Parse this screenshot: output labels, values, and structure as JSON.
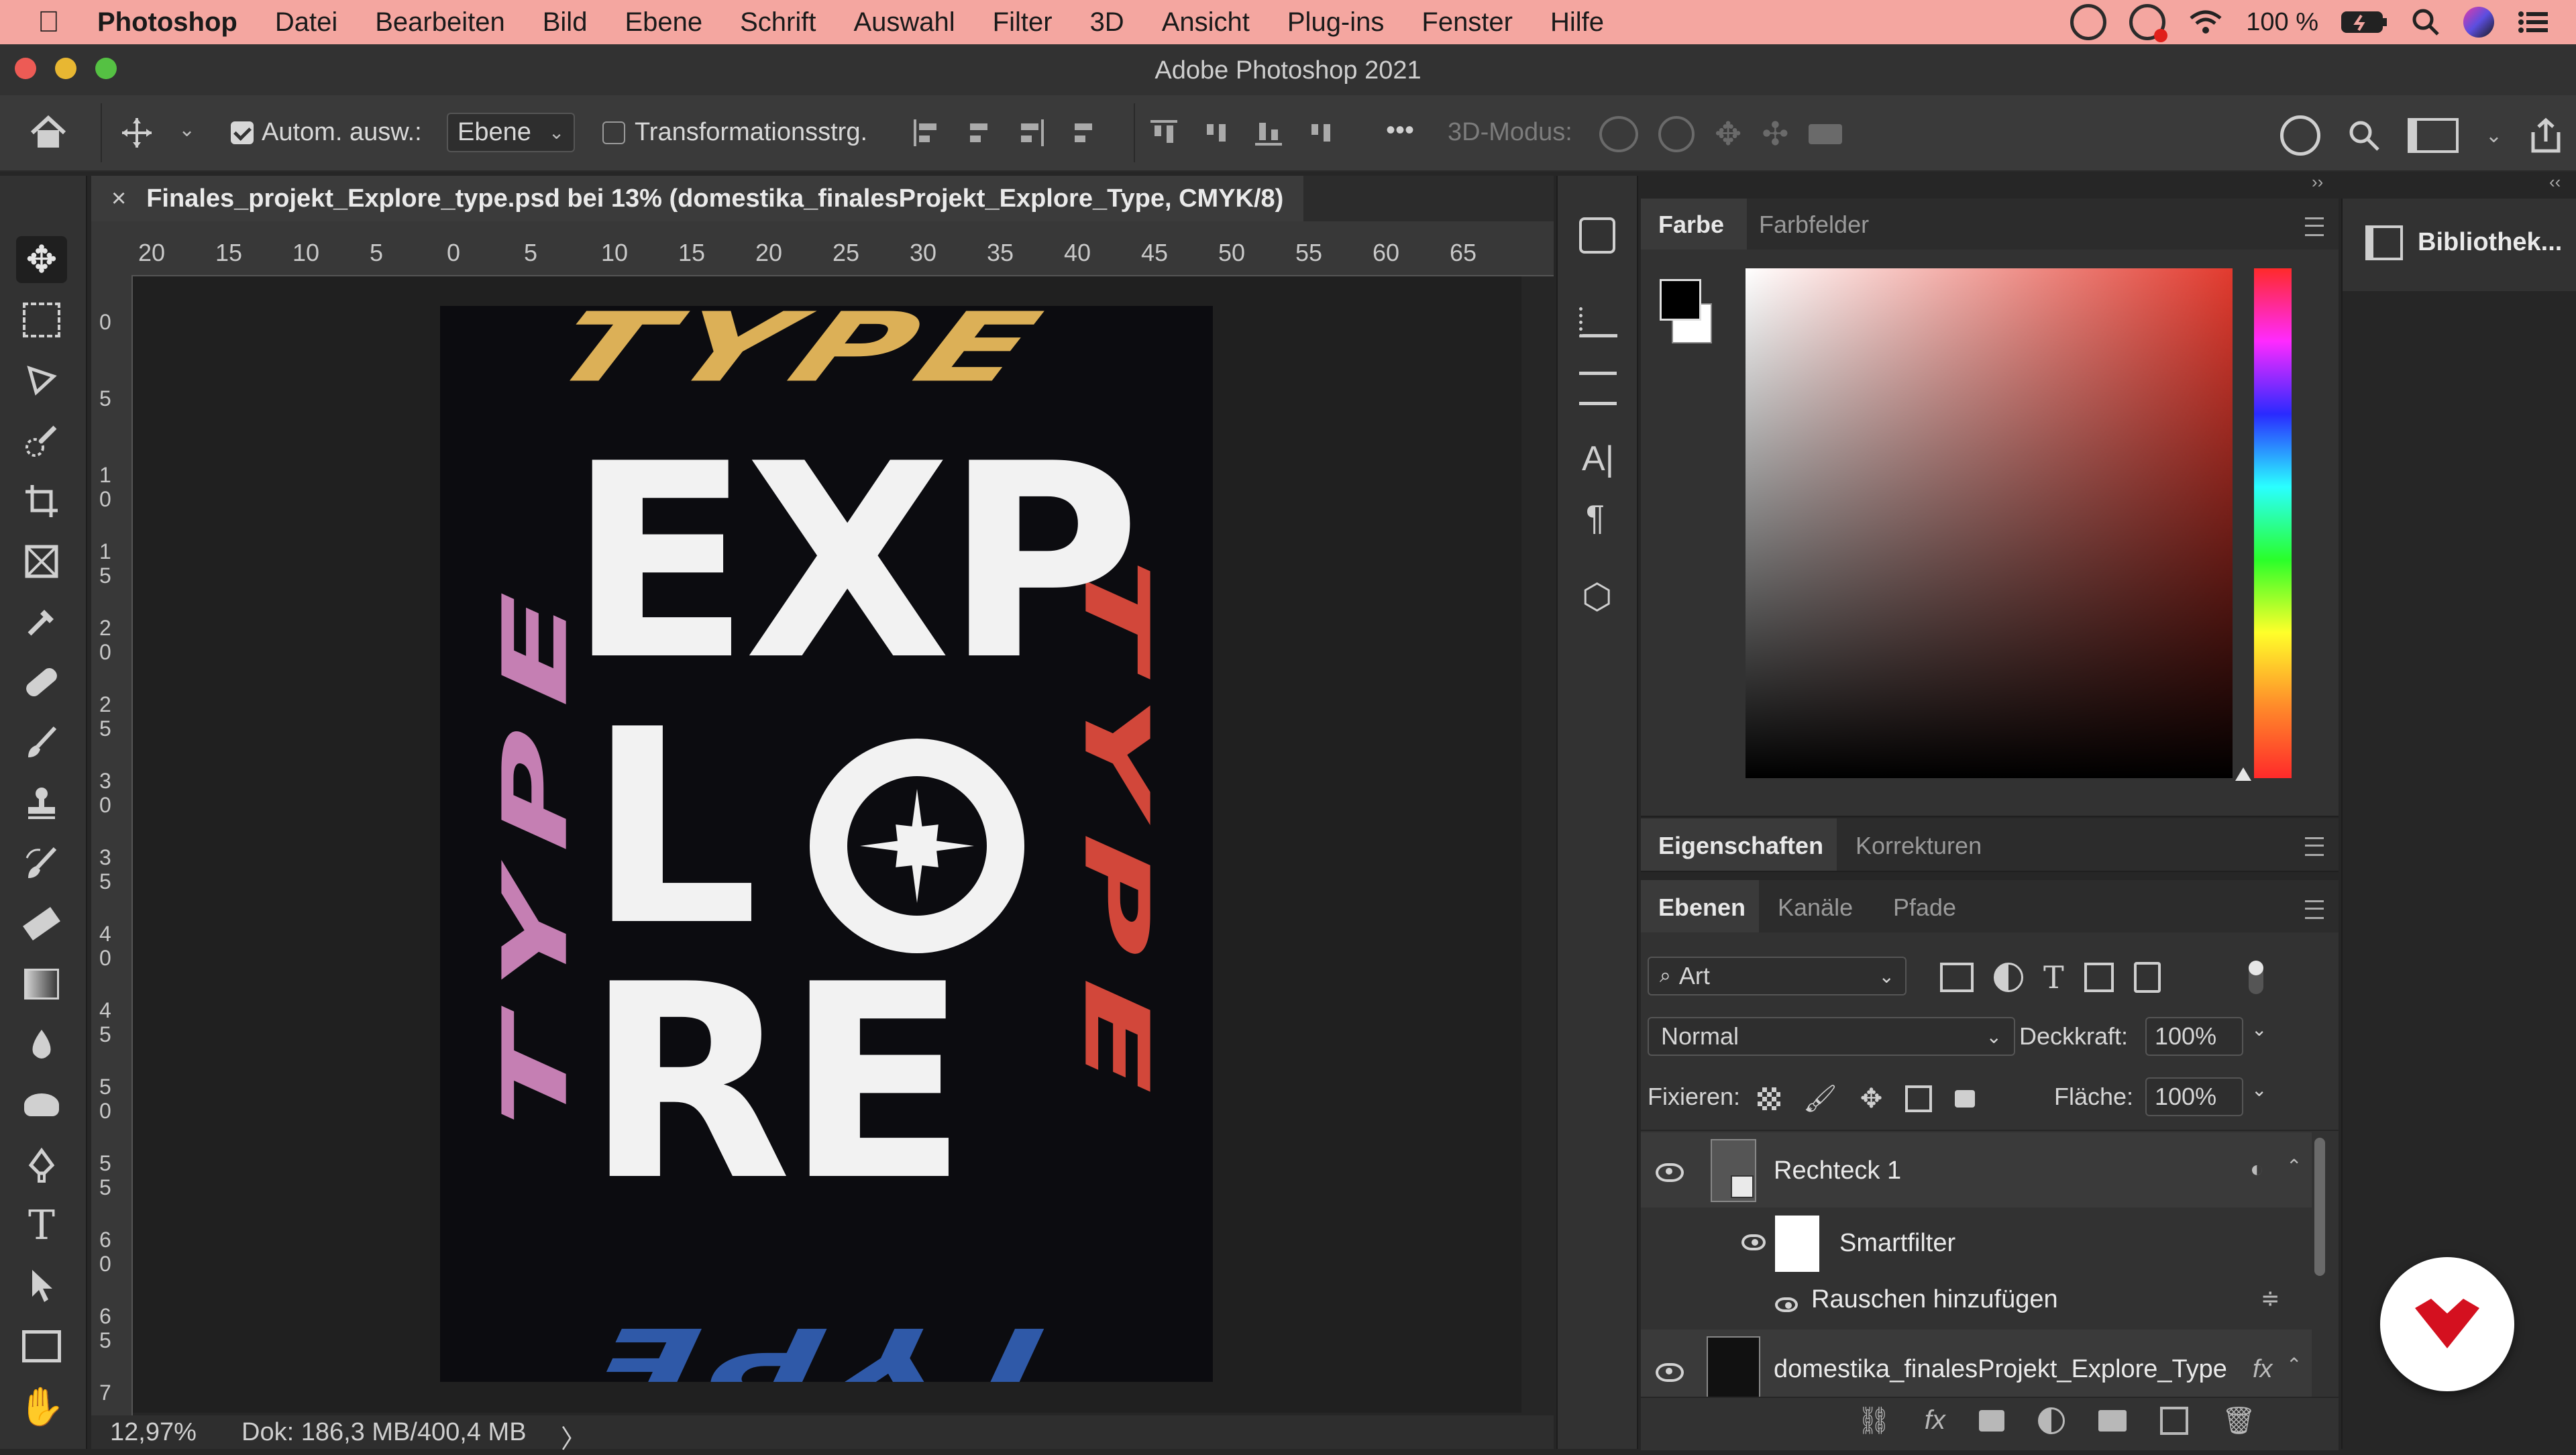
{
  "menubar": {
    "apple": "",
    "app_name": "Photoshop",
    "items": [
      "Datei",
      "Bearbeiten",
      "Bild",
      "Ebene",
      "Schrift",
      "Auswahl",
      "Filter",
      "3D",
      "Ansicht",
      "Plug-ins",
      "Fenster",
      "Hilfe"
    ],
    "battery": "100 %"
  },
  "window": {
    "title": "Adobe Photoshop 2021"
  },
  "options_bar": {
    "auto_select_label": "Autom. ausw.:",
    "auto_select_value": "Ebene",
    "transform_label": "Transformationsstrg.",
    "mode_3d_label": "3D-Modus:",
    "more": "•••"
  },
  "document_tab": {
    "close": "×",
    "title": "Finales_projekt_Explore_type.psd bei 13% (domestika_finalesProjekt_Explore_Type, CMYK/8)"
  },
  "ruler_top": [
    "20",
    "15",
    "10",
    "5",
    "0",
    "5",
    "10",
    "15",
    "20",
    "25",
    "30",
    "35",
    "40",
    "45",
    "50",
    "55",
    "60",
    "65"
  ],
  "ruler_left": [
    "0",
    "5",
    "1\n0",
    "1\n5",
    "2\n0",
    "2\n5",
    "3\n0",
    "3\n5",
    "4\n0",
    "4\n5",
    "5\n0",
    "5\n5",
    "6\n0",
    "6\n5",
    "7"
  ],
  "poster": {
    "top_word": "TYPE",
    "bottom_word": "TYPE",
    "left_word": "TYPE",
    "right_word": "TYPE",
    "line1": "EXP",
    "line2_a": "L",
    "line3": "RE",
    "colors": {
      "background": "#0c0c10",
      "yellow": "#dcb057",
      "pink": "#c57fb3",
      "red": "#d2473a",
      "blue": "#2f59a8",
      "white": "#f2f2f2"
    }
  },
  "status": {
    "zoom": "12,97%",
    "doc": "Dok: 186,3 MB/400,4 MB",
    "arrow": "〉"
  },
  "color_panel": {
    "tabs": [
      "Farbe",
      "Farbfelder"
    ]
  },
  "properties_panel": {
    "tabs": [
      "Eigenschaften",
      "Korrekturen"
    ]
  },
  "layers_panel": {
    "tabs": [
      "Ebenen",
      "Kanäle",
      "Pfade"
    ],
    "filter_kind": "Art",
    "blend_mode": "Normal",
    "opacity_label": "Deckkraft:",
    "opacity_value": "100%",
    "lock_label": "Fixieren:",
    "fill_label": "Fläche:",
    "fill_value": "100%",
    "layers": [
      {
        "name": "Rechteck 1"
      },
      {
        "name": "Smartfilter"
      },
      {
        "name": "Rauschen hinzufügen"
      },
      {
        "name": "domestika_finalesProjekt_Explore_Type",
        "fx": "fx"
      }
    ]
  },
  "library_panel": {
    "title": "Bibliothek..."
  }
}
